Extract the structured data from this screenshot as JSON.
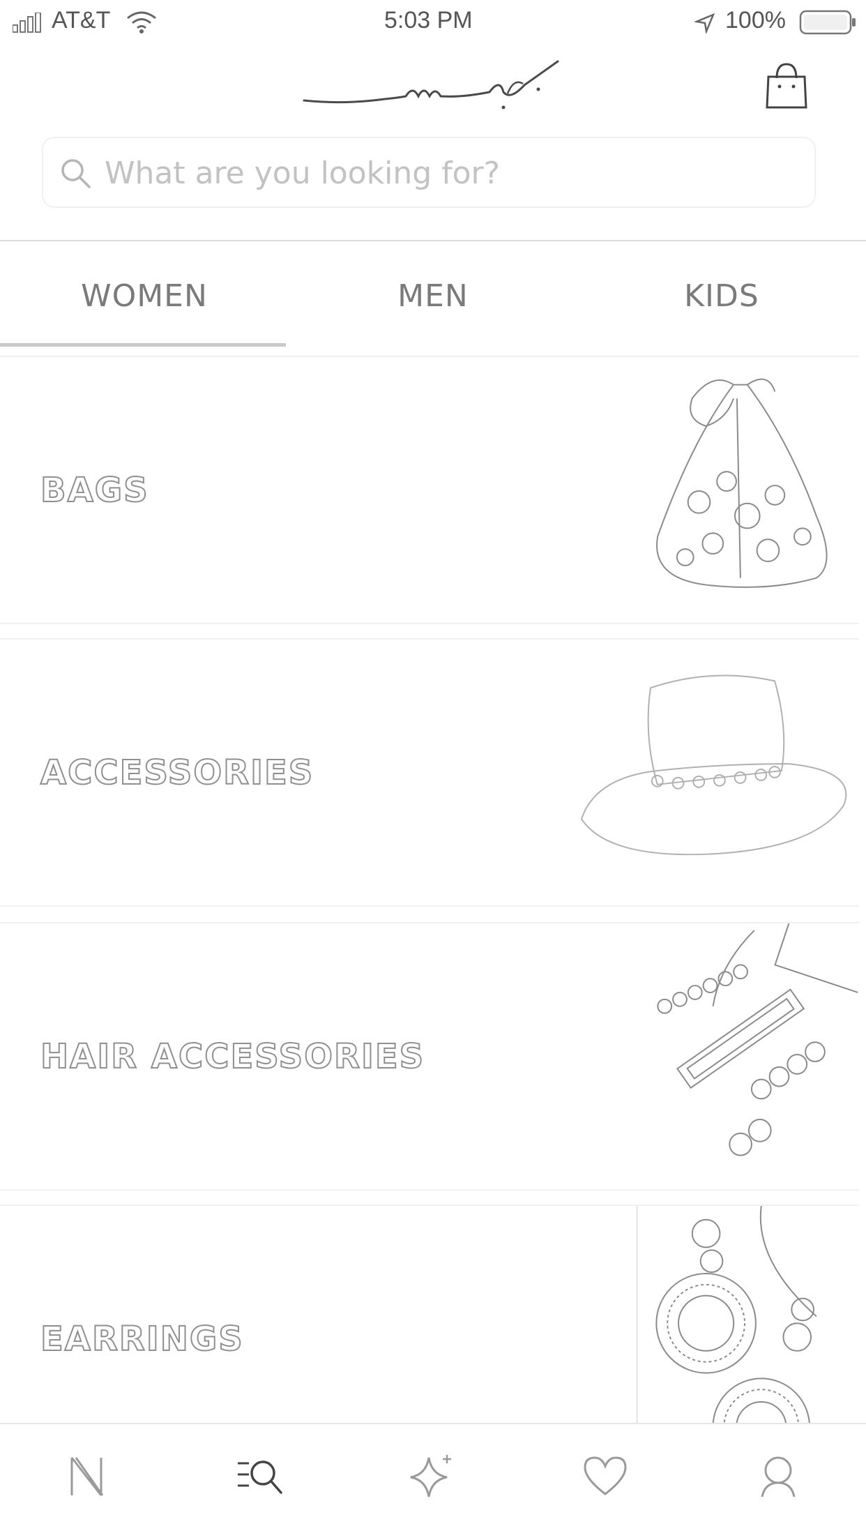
{
  "status_bar": {
    "carrier": "AT&T",
    "time": "5:03 PM",
    "battery": "100%"
  },
  "header": {
    "logo_icon": "signature-logo",
    "cart_icon": "shopping-bag-icon"
  },
  "search": {
    "placeholder": "What are you looking for?",
    "value": ""
  },
  "tabs": [
    {
      "label": "WOMEN",
      "active": true
    },
    {
      "label": "MEN",
      "active": false
    },
    {
      "label": "KIDS",
      "active": false
    }
  ],
  "categories": [
    {
      "label": "BAGS",
      "image": "lace-bag"
    },
    {
      "label": "ACCESSORIES",
      "image": "straw-hat"
    },
    {
      "label": "HAIR ACCESSORIES",
      "image": "pearl-hair-clips"
    },
    {
      "label": "EARRINGS",
      "image": "rattan-earrings"
    }
  ],
  "bottom_nav": [
    {
      "icon": "n-logo-icon",
      "active": false
    },
    {
      "icon": "search-menu-icon",
      "active": true
    },
    {
      "icon": "sparkle-icon",
      "active": false
    },
    {
      "icon": "heart-icon",
      "active": false
    },
    {
      "icon": "profile-icon",
      "active": false
    }
  ],
  "colors": {
    "text": "#6a6a6a",
    "divider": "#dcdcdc",
    "background": "#ffffff"
  }
}
